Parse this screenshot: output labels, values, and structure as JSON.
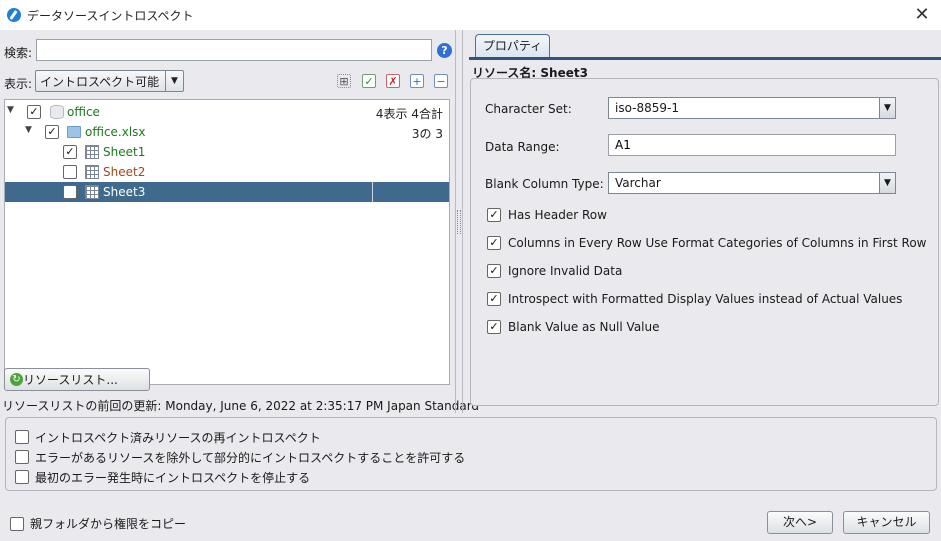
{
  "window": {
    "title": "データソースイントロスペクト",
    "close_glyph": "✕"
  },
  "left": {
    "search_label": "検索:",
    "search_value": "",
    "help_glyph": "?",
    "view_label": "表示:",
    "view_selected": "イントロスペクト可能",
    "tree": [
      {
        "label": "office",
        "count": "4表示 4合計",
        "checked": true,
        "expanded": true
      },
      {
        "label": "office.xlsx",
        "count": "3の 3",
        "checked": true,
        "expanded": true
      },
      {
        "label": "Sheet1",
        "checked": true
      },
      {
        "label": "Sheet2",
        "checked": false
      },
      {
        "label": "Sheet3",
        "checked": false,
        "selected": true
      }
    ],
    "resource_list_button": "リソースリスト...",
    "last_update": "リソースリストの前回の更新: Monday, June 6, 2022 at 2:35:17 PM Japan Standard"
  },
  "right": {
    "tab_label": "プロパティ",
    "resource_name": "リソース名: Sheet3",
    "character_set_label": "Character Set:",
    "character_set_value": "iso-8859-1",
    "data_range_label": "Data Range:",
    "data_range_value": "A1",
    "blank_column_type_label": "Blank Column Type:",
    "blank_column_type_value": "Varchar",
    "checks": [
      {
        "label": "Has Header Row",
        "checked": true
      },
      {
        "label": "Columns in Every Row Use Format Categories of Columns in First Row",
        "checked": true
      },
      {
        "label": "Ignore Invalid Data",
        "checked": true
      },
      {
        "label": "Introspect with Formatted Display Values instead of Actual Values",
        "checked": true
      },
      {
        "label": "Blank Value as Null Value",
        "checked": true
      }
    ]
  },
  "options": [
    {
      "label": "イントロスペクト済みリソースの再イントロスペクト",
      "checked": false
    },
    {
      "label": "エラーがあるリソースを除外して部分的にイントロスペクトすることを許可する",
      "checked": false
    },
    {
      "label": "最初のエラー発生時にイントロスペクトを停止する",
      "checked": false
    }
  ],
  "footer": {
    "copy_permissions": "親フォルダから権限をコピー",
    "next_button": "次へ>",
    "cancel_button": "キャンセル"
  },
  "colors": {
    "selection": "#3f6a8e",
    "tab_border": "#34527e",
    "green_label": "#1d7a1d",
    "brown_label": "#a0481a"
  }
}
